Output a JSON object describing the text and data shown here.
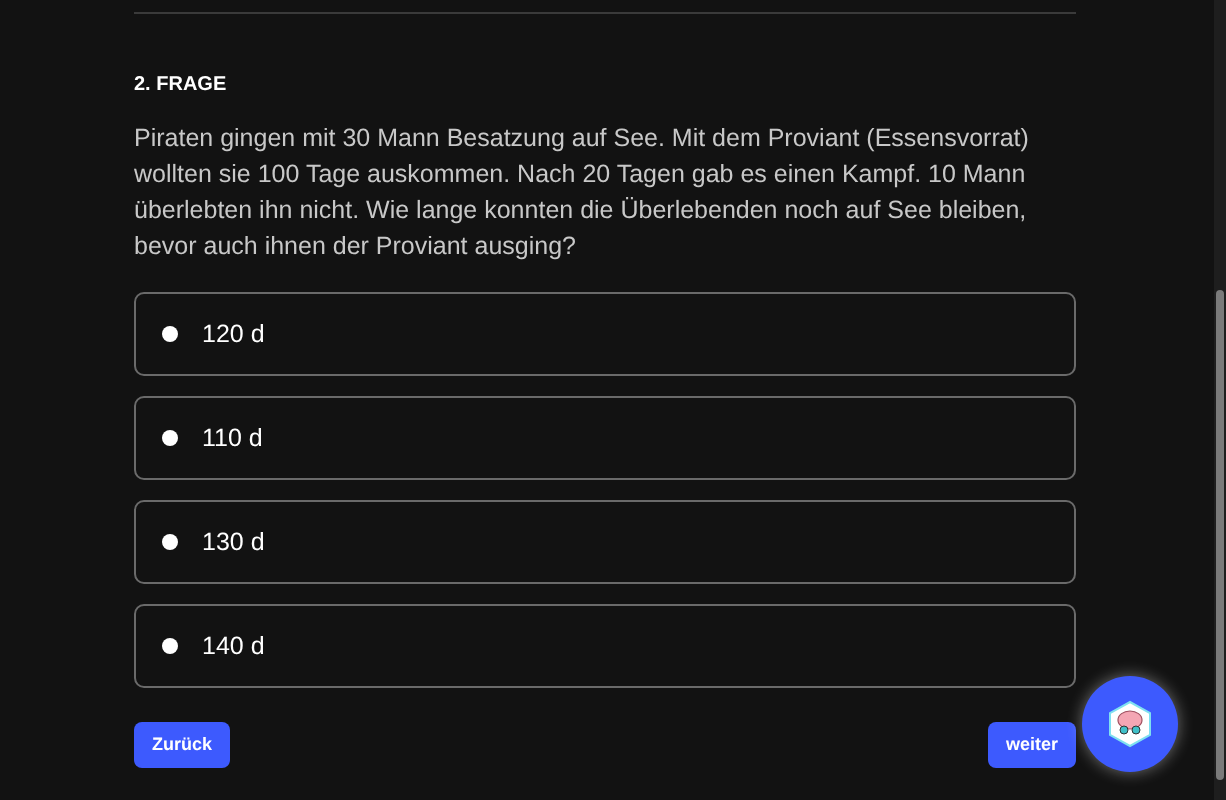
{
  "question": {
    "label": "2. FRAGE",
    "text": "Piraten gingen mit 30 Mann Besatzung auf See. Mit dem Proviant (Essensvorrat) wollten sie 100 Tage auskommen. Nach 20 Tagen gab es einen Kampf. 10 Mann überlebten ihn nicht. Wie lange konnten die Überlebenden noch auf See bleiben, bevor auch ihnen der Proviant ausging?"
  },
  "options": [
    {
      "label": "120 d",
      "selected": false
    },
    {
      "label": "110 d",
      "selected": false
    },
    {
      "label": "130 d",
      "selected": false
    },
    {
      "label": "140 d",
      "selected": false
    }
  ],
  "buttons": {
    "back": "Zurück",
    "next": "weiter"
  }
}
